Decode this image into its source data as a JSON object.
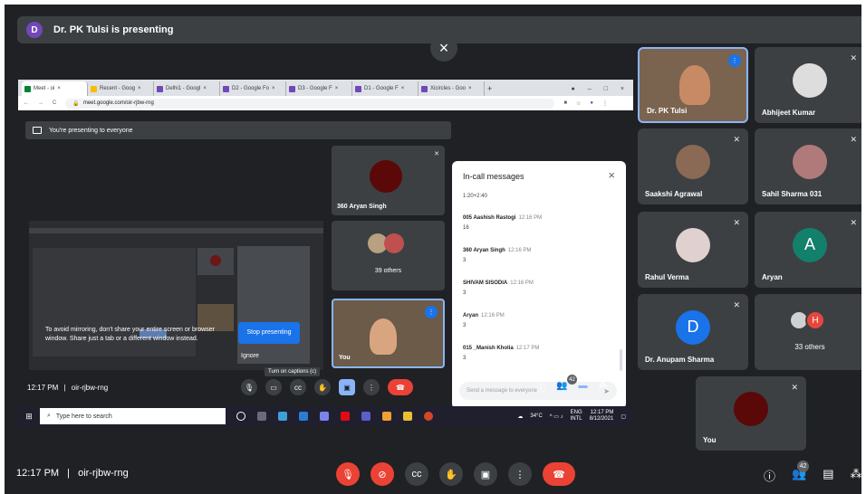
{
  "presenting_bar": {
    "avatar_letter": "D",
    "text": "Dr. PK Tulsi is presenting"
  },
  "close_icon": "×",
  "browser": {
    "tabs": [
      {
        "label": "Meet - oi",
        "active": true
      },
      {
        "label": "Recent - Goog",
        "active": false
      },
      {
        "label": "Delhi1 - Googl",
        "active": false
      },
      {
        "label": "D2 - Google Fo",
        "active": false
      },
      {
        "label": "D3 - Google F",
        "active": false
      },
      {
        "label": "D1 - Google F",
        "active": false
      },
      {
        "label": "Xicircles - Goo",
        "active": false
      }
    ],
    "url": "meet.google.com/oir-rjbw-rng",
    "nav": [
      "←",
      "→",
      "C"
    ]
  },
  "shared_meet": {
    "you_presenting": "You're presenting to everyone",
    "warning": "To avoid mirroring, don't share your entire screen or browser window. Share just a tab or a different window instead.",
    "stop_button": "Stop presenting",
    "ignore": "Ignore",
    "tiles": [
      {
        "name": "360 Aryan Singh"
      },
      {
        "name": "39 others"
      },
      {
        "name": "You"
      }
    ],
    "caption_tooltip": "Turn on captions (c)",
    "time": "12:17 PM",
    "separator": "|",
    "code": "oir-rjbw-rng",
    "people_badge": "42"
  },
  "chat": {
    "title": "In-call messages",
    "intro": "1:20+2:40",
    "messages": [
      {
        "sender": "005 Aashish Rastogi",
        "time": "12:16 PM",
        "text": "16"
      },
      {
        "sender": "360 Aryan Singh",
        "time": "12:16 PM",
        "text": "3"
      },
      {
        "sender": "SHIVAM SISODIA",
        "time": "12:16 PM",
        "text": "3"
      },
      {
        "sender": "Aryan",
        "time": "12:16 PM",
        "text": "3"
      },
      {
        "sender": "015 _Manish Kholia",
        "time": "12:17 PM",
        "text": "3"
      }
    ],
    "input_placeholder": "Send a message to everyone"
  },
  "taskbar": {
    "search_placeholder": "Type here to search",
    "temp": "34°C",
    "lang": "ENG",
    "region": "INTL",
    "clock_time": "12:17 PM",
    "clock_date": "8/12/2021"
  },
  "participants": [
    {
      "name": "Dr. PK Tulsi",
      "type": "video"
    },
    {
      "name": "Abhijeet Kumar",
      "type": "photo"
    },
    {
      "name": "Saakshi Agrawal",
      "type": "photo"
    },
    {
      "name": "Sahil Sharma 031",
      "type": "photo"
    },
    {
      "name": "Rahul Verma",
      "type": "photo"
    },
    {
      "name": "Aryan",
      "type": "letter",
      "letter": "A",
      "color": "#12806a"
    },
    {
      "name": "Dr. Anupam Sharma",
      "type": "letter",
      "letter": "D",
      "color": "#1a73e8"
    },
    {
      "name": "33 others",
      "type": "others",
      "letter": "H",
      "color": "#e8453c"
    },
    {
      "name": "You",
      "type": "photo"
    }
  ],
  "bottom_bar": {
    "time": "12:17 PM",
    "separator": "|",
    "code": "oir-rjbw-rng",
    "people_badge": "42"
  },
  "colors": {
    "background": "#202124",
    "tile": "#3c4043",
    "end_call": "#ea4335",
    "accent": "#1a73e8"
  }
}
